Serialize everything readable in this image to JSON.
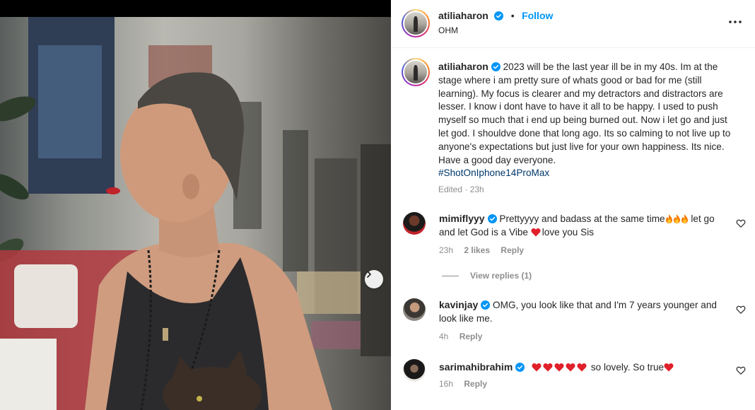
{
  "post": {
    "username": "atiliaharon",
    "follow_label": "Follow",
    "location": "OHM",
    "separator": "•",
    "caption": "2023 will be the last year ill be in my 40s. Im at the stage where i am pretty sure of whats good or bad for me (still learning). My focus is clearer and my detractors and distractors are lesser. I know i dont have to have it all to be happy. I used to push myself so much that i end up being burned out. Now i let go and just let god. I shouldve done that long ago. Its so calming to not live up to anyone's expectations but just live for your own happiness. Its nice. Have a good day everyone.",
    "hashtag": "#ShotOnIphone14ProMax",
    "edited_time": "Edited · 23h"
  },
  "icons": {
    "verified": "verified-badge-icon",
    "more": "more-options-icon",
    "like": "heart-outline-icon",
    "next": "chevron-right-icon",
    "fire": "fire-emoji-icon",
    "red_heart": "red-heart-emoji-icon"
  },
  "colors": {
    "accent": "#0095f6",
    "hashtag": "#00376b",
    "verified": "#0095f6",
    "muted": "#8e8e8e",
    "text": "#262626"
  },
  "comments": [
    {
      "username": "mimiflyyy",
      "text_a": "Prettyyyy and badass at the same time",
      "text_b": " let go and let God is a Vibe ",
      "text_c": "love you Sis",
      "time": "23h",
      "likes": "2 likes",
      "reply": "Reply",
      "view_replies": "View replies (1)"
    },
    {
      "username": "kavinjay",
      "text": "OMG, you look like that and I'm 7 years younger and look like me.",
      "time": "4h",
      "reply": "Reply"
    },
    {
      "username": "sarimahibrahim",
      "text_a": " so lovely. So true",
      "time": "16h",
      "reply": "Reply"
    }
  ]
}
